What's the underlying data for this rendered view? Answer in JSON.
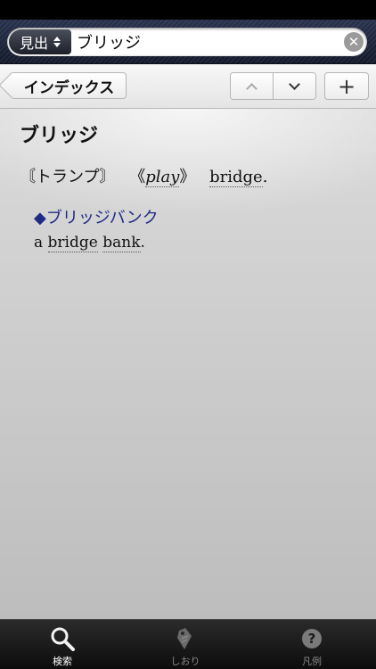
{
  "search": {
    "scope_label": "見出",
    "query": "ブリッジ",
    "clear_glyph": "✕"
  },
  "nav": {
    "back_label": "インデックス",
    "add_label": "+"
  },
  "entry": {
    "headword": "ブリッジ",
    "sense": {
      "domain": "〘トランプ〙",
      "usage_open": "《",
      "usage": "play",
      "usage_close": "》",
      "translation": "bridge",
      "terminator": "."
    },
    "subentry": {
      "title": "◆ブリッジバンク",
      "example_article": "a",
      "example_word1": "bridge",
      "example_word2": "bank",
      "terminator": "."
    }
  },
  "tabs": [
    {
      "label": "検索",
      "icon": "magnifier-icon",
      "selected": true
    },
    {
      "label": "しおり",
      "icon": "bookmark-tag-icon",
      "selected": false
    },
    {
      "label": "凡例",
      "icon": "help-icon",
      "selected": false
    }
  ],
  "colors": {
    "subentry": "#1f2a85",
    "tab_selected": "#ffffff",
    "tab_unselected": "#888888"
  }
}
